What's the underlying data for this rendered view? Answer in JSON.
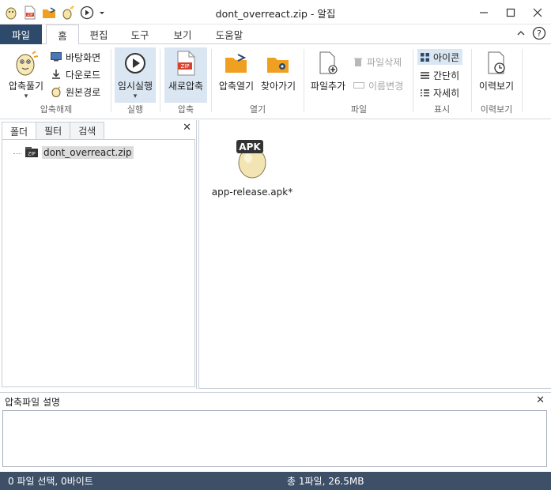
{
  "window": {
    "title": "dont_overreact.zip - 알집",
    "controls": {
      "minimize": "—",
      "maximize": "☐",
      "close": "✕"
    }
  },
  "quick_access": [
    "alzip-egg-icon",
    "zip-file-icon",
    "folder-open-icon",
    "magic-wand-icon",
    "play-icon",
    "dropdown-arrow"
  ],
  "menu": {
    "file_tab": "파일",
    "tabs": [
      {
        "label": "홈",
        "active": true
      },
      {
        "label": "편집",
        "active": false
      },
      {
        "label": "도구",
        "active": false
      },
      {
        "label": "보기",
        "active": false
      },
      {
        "label": "도움말",
        "active": false
      }
    ],
    "collapse_symbol": "︿",
    "help_symbol": "?"
  },
  "ribbon": {
    "groups": {
      "extract": "압축해제",
      "run": "실행",
      "compress": "압축",
      "open": "열기",
      "file": "파일",
      "view": "표시",
      "history": "이력보기"
    },
    "extract_button": "압축풀기",
    "extract_dropdown": "▾",
    "desktop": "바탕화면",
    "download": "다운로드",
    "original_path": "원본경로",
    "temp_run": "임시실행",
    "temp_run_dropdown": "▾",
    "new_compress": "새로압축",
    "open_archive": "압축열기",
    "find_open": "찾아가기",
    "add_file": "파일추가",
    "delete_file": "파일삭제",
    "rename": "이름변경",
    "view_icon": "아이콘",
    "view_simple": "간단히",
    "view_detail": "자세히",
    "history_view": "이력보기"
  },
  "left_panel": {
    "tabs": [
      {
        "label": "폴더",
        "active": true
      },
      {
        "label": "필터",
        "active": false
      },
      {
        "label": "검색",
        "active": false
      }
    ],
    "close": "✕",
    "tree_root": "dont_overreact.zip"
  },
  "main": {
    "files": [
      {
        "name": "app-release.apk*",
        "badge": "APK"
      }
    ]
  },
  "description_panel": {
    "title": "압축파일 설명",
    "close": "✕",
    "text": ""
  },
  "status": {
    "left": "0 파일 선택,  0바이트",
    "right": "총 1파일,  26.5MB"
  },
  "colors": {
    "file_tab_bg": "#2e4a6b",
    "status_bg": "#3e5068",
    "ribbon_highlight": "#dbe6f3",
    "accent_orange": "#f0a020",
    "zip_red": "#d9412b"
  }
}
